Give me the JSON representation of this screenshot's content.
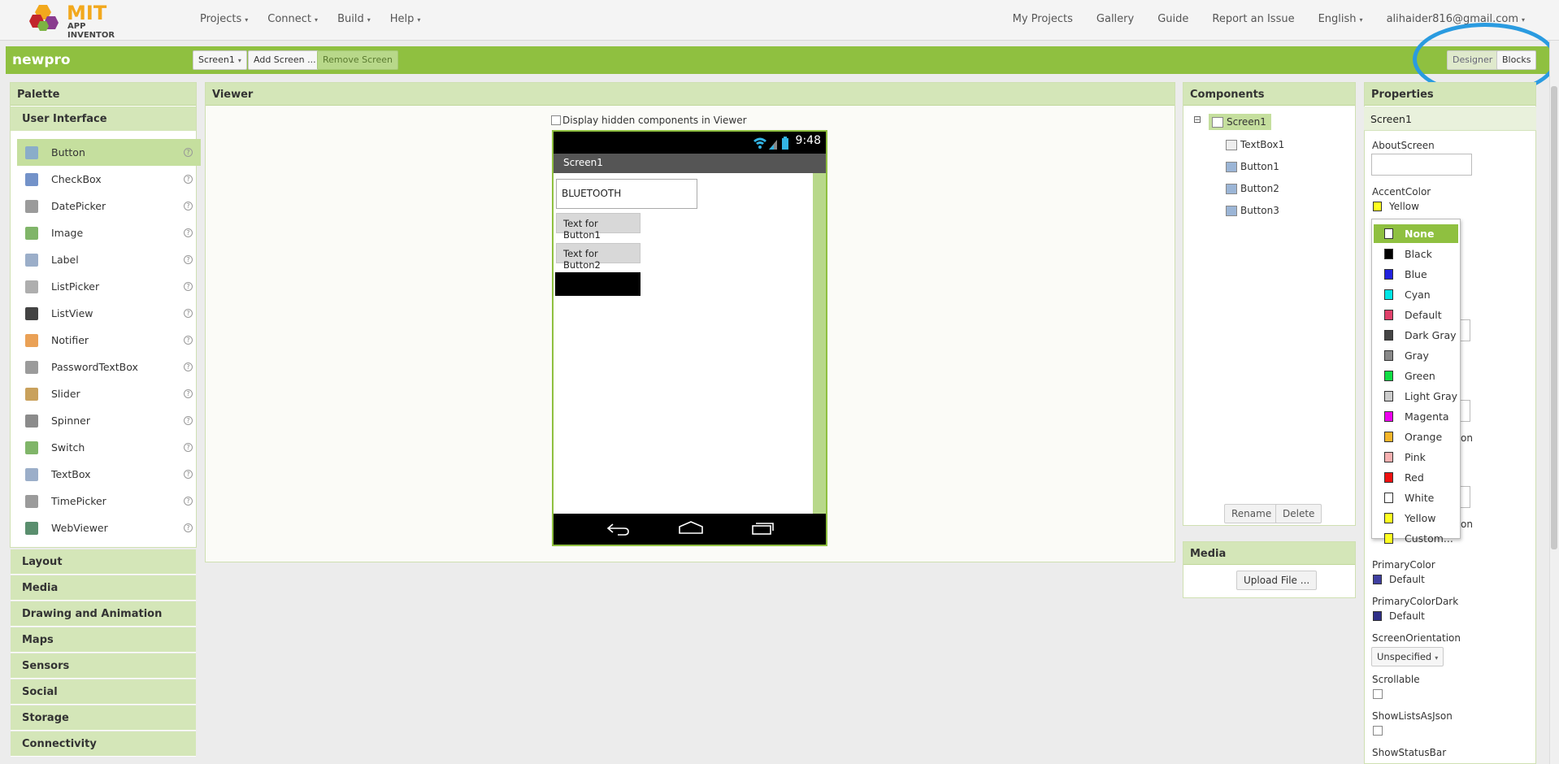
{
  "app": {
    "logo_top": "MIT",
    "logo_bottom": "APP INVENTOR"
  },
  "nav": {
    "left": [
      "Projects",
      "Connect",
      "Build",
      "Help"
    ],
    "right": [
      "My Projects",
      "Gallery",
      "Guide",
      "Report an Issue",
      "English",
      "alihaider816@gmail.com"
    ]
  },
  "project": {
    "name": "newpro",
    "screen_select": "Screen1",
    "add_screen": "Add Screen ...",
    "remove_screen": "Remove Screen",
    "designer": "Designer",
    "blocks": "Blocks"
  },
  "palette": {
    "title": "Palette",
    "category_open": "User Interface",
    "items": [
      "Button",
      "CheckBox",
      "DatePicker",
      "Image",
      "Label",
      "ListPicker",
      "ListView",
      "Notifier",
      "PasswordTextBox",
      "Slider",
      "Spinner",
      "Switch",
      "TextBox",
      "TimePicker",
      "WebViewer"
    ],
    "help_glyph": "?",
    "categories": [
      "Layout",
      "Media",
      "Drawing and Animation",
      "Maps",
      "Sensors",
      "Social",
      "Storage",
      "Connectivity"
    ]
  },
  "viewer": {
    "title": "Viewer",
    "hidden_label": "Display hidden components in Viewer",
    "time": "9:48",
    "screen_title": "Screen1",
    "textbox_value": "BLUETOOTH",
    "button1": "Text for Button1",
    "button2": "Text for Button2"
  },
  "components": {
    "title": "Components",
    "tree": [
      "Screen1",
      "TextBox1",
      "Button1",
      "Button2",
      "Button3"
    ],
    "collapse_glyph": "⊟",
    "rename": "Rename",
    "delete": "Delete"
  },
  "media": {
    "title": "Media",
    "upload": "Upload File ..."
  },
  "properties": {
    "title": "Properties",
    "component": "Screen1",
    "about_screen": "AboutScreen",
    "accent_color": "AccentColor",
    "accent_value": "Yellow",
    "peek_1": "on",
    "peek_2": "on",
    "primary_color": "PrimaryColor",
    "primary_value": "Default",
    "primary_dark": "PrimaryColorDark",
    "primary_dark_value": "Default",
    "orientation": "ScreenOrientation",
    "orientation_value": "Unspecified",
    "scrollable": "Scrollable",
    "show_lists": "ShowListsAsJson",
    "show_status": "ShowStatusBar"
  },
  "color_menu": [
    {
      "name": "None",
      "color": "#ffffff"
    },
    {
      "name": "Black",
      "color": "#000000"
    },
    {
      "name": "Blue",
      "color": "#2222dd"
    },
    {
      "name": "Cyan",
      "color": "#00e5e5"
    },
    {
      "name": "Default",
      "color": "#e0406a"
    },
    {
      "name": "Dark Gray",
      "color": "#444444"
    },
    {
      "name": "Gray",
      "color": "#888888"
    },
    {
      "name": "Green",
      "color": "#11dd44"
    },
    {
      "name": "Light Gray",
      "color": "#cccccc"
    },
    {
      "name": "Magenta",
      "color": "#ee00ee"
    },
    {
      "name": "Orange",
      "color": "#f5b52a"
    },
    {
      "name": "Pink",
      "color": "#f7b0b0"
    },
    {
      "name": "Red",
      "color": "#ee1111"
    },
    {
      "name": "White",
      "color": "#ffffff"
    },
    {
      "name": "Yellow",
      "color": "#ffff22"
    },
    {
      "name": "Custom...",
      "color": "#ffff22"
    }
  ],
  "colors": {
    "accent": "#8fc040",
    "panel_header": "#d4e6b8",
    "ring": "#2a9be0",
    "primary_swatch": "#3f3fa0"
  }
}
